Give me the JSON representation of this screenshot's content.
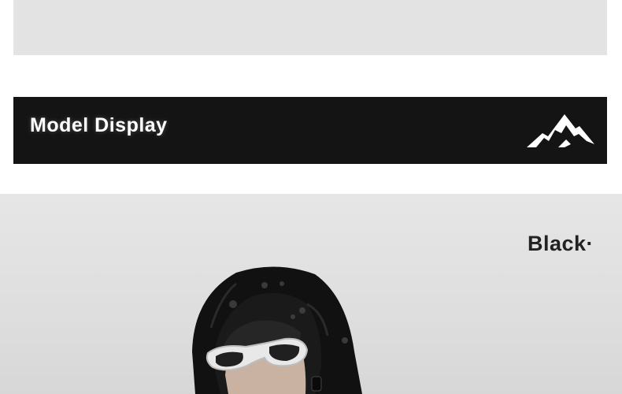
{
  "banner": {
    "title": "Model Display",
    "icon": "mountain-icon",
    "background": "#141414"
  },
  "photo": {
    "color_label": "Black·",
    "subject": "model-wearing-black-hooded-jacket-and-white-sunglasses"
  },
  "colors": {
    "panel_gray": "#e3e3e3",
    "banner_bg": "#141414",
    "label_text": "#222222"
  }
}
